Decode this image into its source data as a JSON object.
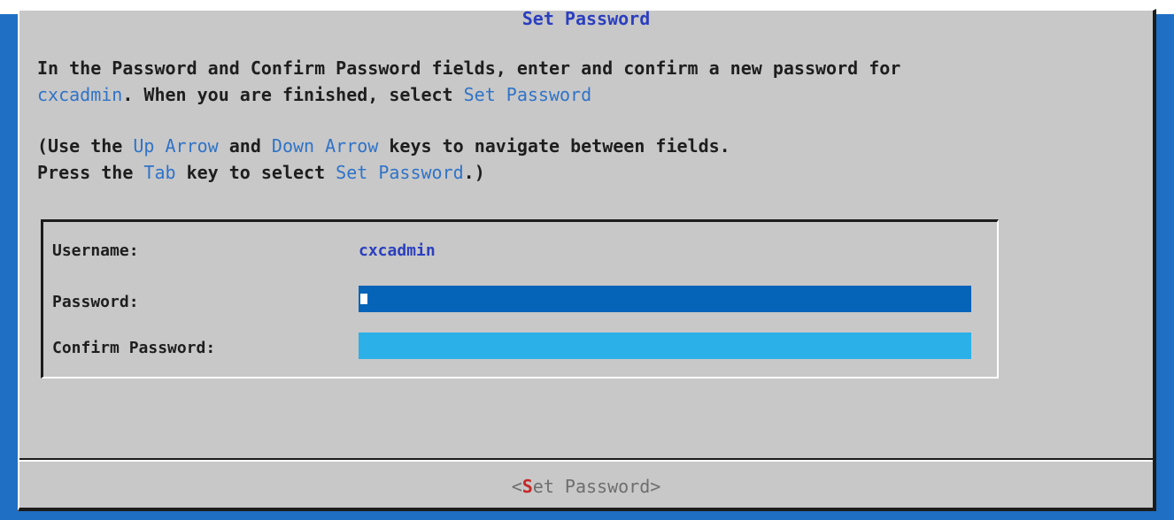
{
  "dialog": {
    "title": "Set Password",
    "intro": {
      "text1": "In the Password and Confirm Password fields, enter and confirm a new password for",
      "user": "cxcadmin",
      "text2": ". When you are finished, select ",
      "action": "Set Password"
    },
    "help": {
      "use_the": "(Use the ",
      "up_arrow": "Up Arrow",
      "and": " and ",
      "down_arrow": "Down Arrow",
      "navigate": " keys to navigate between fields.",
      "press_the": "Press the ",
      "tab": "Tab",
      "key_to_select": " key to select ",
      "set_password": "Set Password",
      "closing": ".)"
    },
    "form": {
      "username_label": "Username:",
      "username_value": "cxcadmin",
      "password_label": "Password:",
      "password_value": "",
      "confirm_label": "Confirm Password:",
      "confirm_value": ""
    },
    "button": {
      "open": "<",
      "hotkey": "S",
      "rest": "et Password",
      "close": ">"
    }
  },
  "colors": {
    "background": "#1f6fc4",
    "dialog": "#c8c8c8",
    "title": "#2b3fbf",
    "highlight": "#2f73c8",
    "password_field": "#0563b8",
    "confirm_field": "#2bb0e8",
    "hotkey": "#c62828"
  }
}
